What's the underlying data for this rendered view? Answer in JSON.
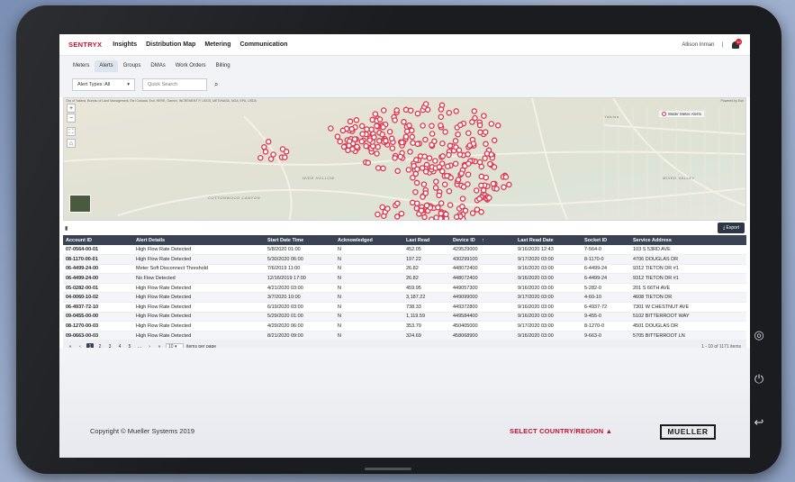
{
  "brand": "SENTRYX",
  "nav": {
    "items": [
      "Insights",
      "Distribution Map",
      "Metering",
      "Communication"
    ],
    "user": "Allison Inman",
    "separator": "|",
    "bell_badge": "10"
  },
  "tabs": {
    "items": [
      "Meters",
      "Alerts",
      "Groups",
      "DMAs",
      "Work Orders",
      "Billing"
    ],
    "active": "Alerts"
  },
  "filters": {
    "alert_type": "Alert Types: All",
    "search_placeholder": "Quick Search"
  },
  "map": {
    "attribution": "City of Yakima, Bureau of Land Management, Esri Canada, Esri, HERE, Garmin, INCREMENT P, USGS, METI/NASA, NGA, EPA, USDA",
    "powered_by": "Powered by Esri",
    "legend": "Water Meter Alerts",
    "labels": [
      "WIDE HOLLOW",
      "COTTONWOOD CANYON",
      "MIXED VALLEY",
      "Yakima"
    ],
    "marker_color": "#e0324a"
  },
  "toolbar": {
    "export_label": "Export"
  },
  "table": {
    "columns": [
      "Account ID",
      "Alert Details",
      "Start Date Time",
      "Acknowledged",
      "Last Read",
      "Device ID",
      "Last Read Date",
      "Socket ID",
      "Service Address"
    ],
    "sort_indicator": "↑",
    "rows": [
      [
        "07-0564-00-01",
        "High Flow Rate Detected",
        "5/8/2020 01:00",
        "N",
        "452.05",
        "429529000",
        "9/16/2020 12:43",
        "7-564-0",
        "103 S 53RD AVE"
      ],
      [
        "08-1170-00-01",
        "High Flow Rate Detected",
        "5/30/2020 06:00",
        "N",
        "197.22",
        "430299100",
        "9/17/2020 03:00",
        "8-1170-0",
        "4706 DOUGLAS DR"
      ],
      [
        "06-4499-24-00",
        "Meter Soft Disconnect Threshold",
        "7/6/2019 11:00",
        "N",
        "26.82",
        "448072400",
        "9/16/2020 03:00",
        "6-4499-24",
        "9312 TIETON DR #1"
      ],
      [
        "06-4499-24-00",
        "No Flow Detected",
        "12/16/2019 17:00",
        "N",
        "26.82",
        "448072400",
        "9/16/2020 03:00",
        "6-4499-24",
        "9312 TIETON DR #1"
      ],
      [
        "05-0282-00-01",
        "High Flow Rate Detected",
        "4/21/2020 03:00",
        "N",
        "459.95",
        "449057300",
        "9/16/2020 03:00",
        "5-282-0",
        "201 S 66TH AVE"
      ],
      [
        "04-0060-10-02",
        "High Flow Rate Detected",
        "3/7/2020 10:00",
        "N",
        "3,187.22",
        "449099000",
        "9/17/2020 03:00",
        "4-60-10",
        "4608 TIETON DR"
      ],
      [
        "06-4937-72-10",
        "High Flow Rate Detected",
        "6/19/2020 03:00",
        "N",
        "738.33",
        "449372800",
        "9/16/2020 03:00",
        "6-4937-72",
        "7301 W CHESTNUT AVE"
      ],
      [
        "09-0455-00-00",
        "High Flow Rate Detected",
        "5/29/2020 01:00",
        "N",
        "1,119.59",
        "449584400",
        "9/16/2020 03:00",
        "9-455-0",
        "5102 BITTERROOT WAY"
      ],
      [
        "08-1270-00-03",
        "High Flow Rate Detected",
        "4/29/2020 06:00",
        "N",
        "353.79",
        "450405000",
        "9/17/2020 03:00",
        "8-1270-0",
        "4501 DOUGLAS DR"
      ],
      [
        "09-0663-00-03",
        "High Flow Rate Detected",
        "8/21/2020 09:00",
        "N",
        "324.69",
        "458068900",
        "9/16/2020 03:00",
        "9-663-0",
        "5705 BITTERROOT LN"
      ]
    ]
  },
  "pager": {
    "first": "«",
    "prev": "‹",
    "pages": [
      "1",
      "2",
      "3",
      "4",
      "5",
      "..."
    ],
    "next": "›",
    "last": "»",
    "per_page": "10",
    "per_page_label": "items per page",
    "total": "1 - 10 of 1171 items"
  },
  "footer": {
    "copyright": "Copyright © Mueller Systems 2019",
    "region": "SELECT COUNTRY/REGION ▲",
    "logo": "MUELLER"
  },
  "icons": [
    "bell-icon",
    "search-icon",
    "zoom-in-icon",
    "zoom-out-icon",
    "fullscreen-icon",
    "home-icon",
    "grip-icon",
    "export-icon",
    "power-icon",
    "back-icon",
    "camera-icon"
  ]
}
